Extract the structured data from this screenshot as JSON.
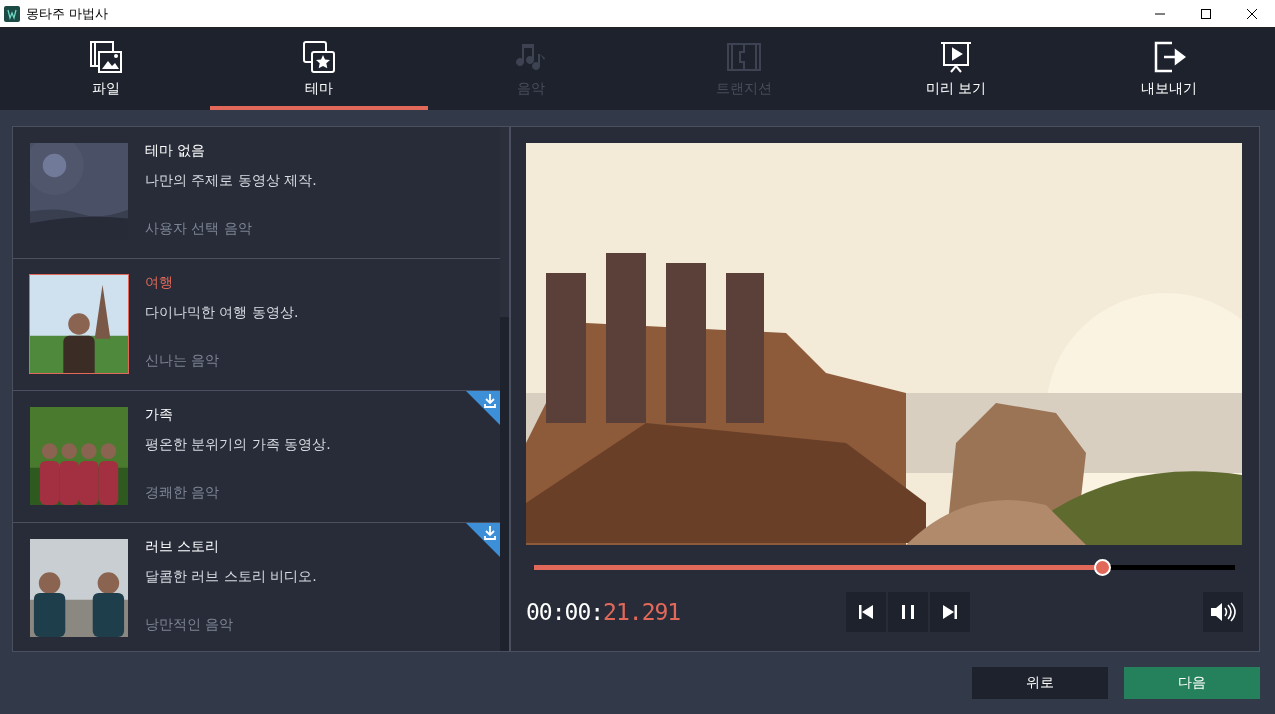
{
  "window": {
    "title": "몽타주 마법사"
  },
  "tabs": [
    {
      "kind": "file",
      "label": "파일",
      "selected": false,
      "disabled": false
    },
    {
      "kind": "theme",
      "label": "테마",
      "selected": true,
      "disabled": false
    },
    {
      "kind": "music",
      "label": "음악",
      "selected": false,
      "disabled": true
    },
    {
      "kind": "transition",
      "label": "트랜지션",
      "selected": false,
      "disabled": true
    },
    {
      "kind": "preview",
      "label": "미리 보기",
      "selected": false,
      "disabled": false
    },
    {
      "kind": "export",
      "label": "내보내기",
      "selected": false,
      "disabled": false
    }
  ],
  "themes": [
    {
      "title": "테마 없음",
      "description": "나만의 주제로 동영상 제작.",
      "music": "사용자 선택 음악",
      "selected": false,
      "downloadable": false,
      "kind": "placeholder"
    },
    {
      "title": "여행",
      "description": "다이나믹한 여행 동영상.",
      "music": "신나는 음악",
      "selected": true,
      "downloadable": false
    },
    {
      "title": "가족",
      "description": "평온한 분위기의 가족 동영상.",
      "music": "경쾌한 음악",
      "selected": false,
      "downloadable": true
    },
    {
      "title": "러브 스토리",
      "description": "달콤한 러브 스토리 비디오.",
      "music": "낭만적인 음악",
      "selected": false,
      "downloadable": true
    }
  ],
  "player": {
    "level": 0.81,
    "time_elapsed": "00:00:",
    "time_fraction": "21.291"
  },
  "buttons": [
    {
      "kind": "back",
      "label": "위로"
    },
    {
      "kind": "next",
      "label": "다음"
    }
  ]
}
